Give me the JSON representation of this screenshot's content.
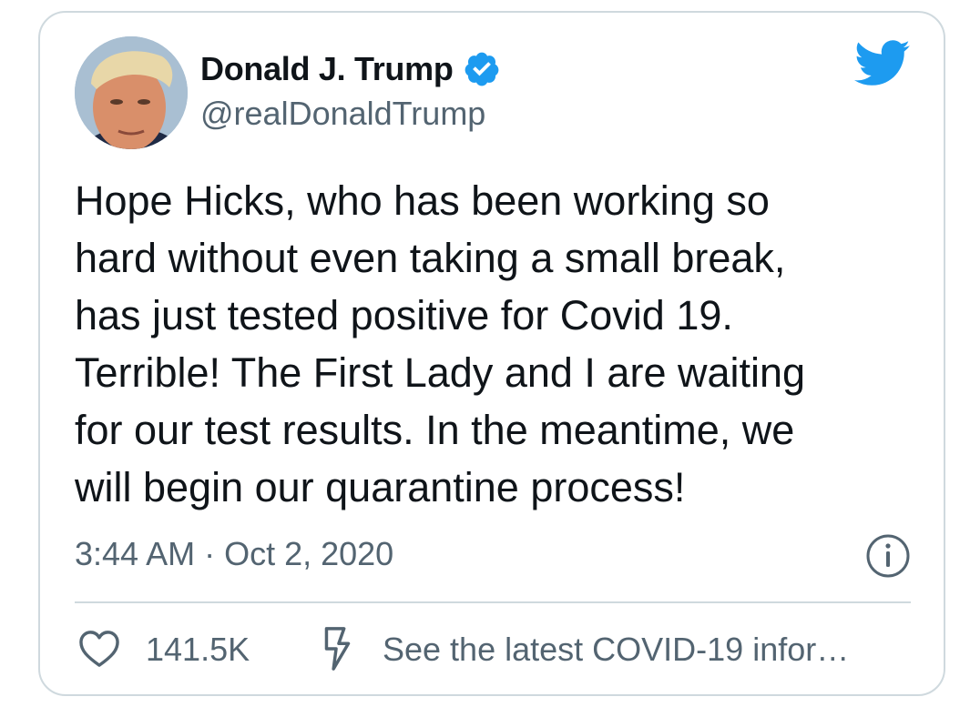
{
  "tweet": {
    "author": {
      "display_name": "Donald J. Trump",
      "handle": "@realDonaldTrump",
      "verified": true
    },
    "text_lines": [
      "Hope Hicks, who has been working so",
      "hard without even taking a small break,",
      "has just tested positive for Covid 19.",
      "Terrible! The First Lady and I are waiting",
      "for our test results. In the meantime, we",
      "will begin our quarantine process!"
    ],
    "timestamp": "3:44 AM · Oct 2, 2020",
    "likes": "141.5K",
    "notice_link": "See the latest COVID-19 infor…"
  },
  "icons": {
    "verified": "verified-badge-icon",
    "twitter": "twitter-bird-icon",
    "info": "info-icon",
    "like": "heart-icon",
    "notice": "lightning-bolt-icon"
  },
  "colors": {
    "text": "#0f1419",
    "secondary": "#536471",
    "brand_blue": "#1d9bf0",
    "border": "#cfd9de"
  }
}
